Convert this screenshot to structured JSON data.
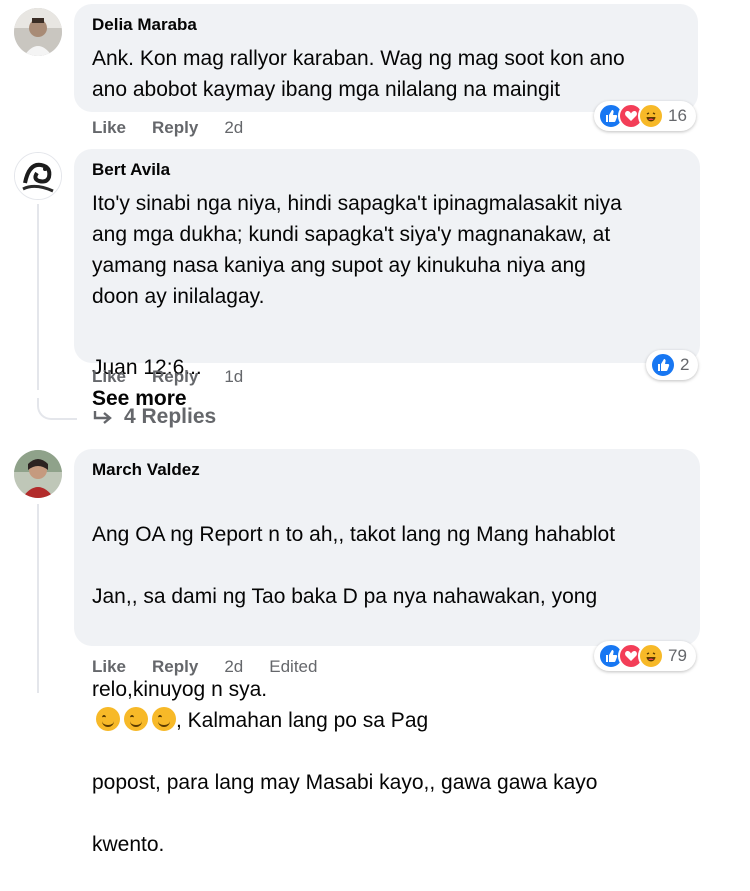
{
  "comments": [
    {
      "author": "Delia Maraba",
      "text": "Ank. Kon mag rallyor karaban. Wag ng mag soot kon ano\nano abobot kaymay ibang mga nilalang na maingit",
      "actions": {
        "like": "Like",
        "reply": "Reply",
        "time": "2d"
      },
      "reactions": {
        "icons": [
          "like-icon",
          "love-icon",
          "haha-icon"
        ],
        "count": "16"
      }
    },
    {
      "author": "Bert Avila",
      "text": "Ito'y sinabi nga niya, hindi sapagka't ipinagmalasakit niya\nang mga dukha; kundi sapagka't siya'y magnanakaw, at\nyamang nasa kaniya ang supot ay kinukuha niya ang\ndoon ay inilalagay.",
      "extra_text": "Juan 12:6...",
      "see_more": "See more",
      "actions": {
        "like": "Like",
        "reply": "Reply",
        "time": "1d"
      },
      "reactions": {
        "icons": [
          "like-icon"
        ],
        "count": "2"
      },
      "replies_label": "4 Replies"
    },
    {
      "author": "March Valdez",
      "text_line1": "Ang OA ng Report n to ah,, takot lang ng Mang hahablot",
      "text_line2": "Jan,, sa dami ng Tao baka D pa nya nahawakan, yong",
      "text_line3_start": "relo,kinuyog n sya.",
      "text_line3_end": ", Kalmahan lang po sa Pag",
      "text_line4": "popost, para lang may Masabi kayo,, gawa gawa kayo",
      "text_line5": "kwento.",
      "actions": {
        "like": "Like",
        "reply": "Reply",
        "time": "2d",
        "edited": "Edited"
      },
      "reactions": {
        "icons": [
          "like-icon",
          "love-icon",
          "haha-icon"
        ],
        "count": "79"
      }
    }
  ],
  "colors": {
    "bubble": "#f0f2f5",
    "meta_text": "#65676b",
    "like_blue": "#1877f2",
    "love_red": "#f33e58",
    "haha_yellow": "#f7b928"
  }
}
